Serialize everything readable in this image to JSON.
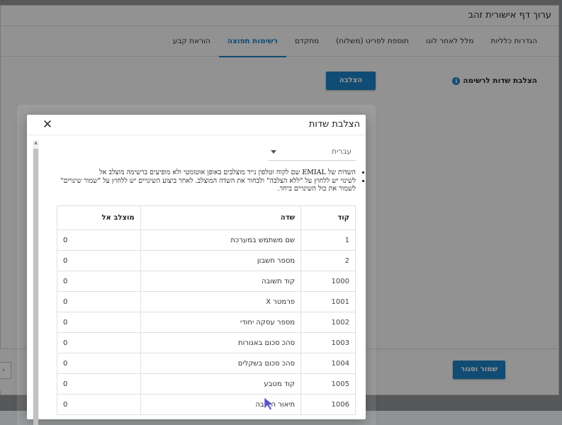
{
  "window": {
    "title": "ערוך דף אישורית זהב"
  },
  "tabs": [
    {
      "label": "הגדרות כלליות",
      "active": false
    },
    {
      "label": "מלל לאחר לוגו",
      "active": false
    },
    {
      "label": "תוספת לפריט (משלוח)",
      "active": false
    },
    {
      "label": "מתקדם",
      "active": false
    },
    {
      "label": "רשימות תפוצה",
      "active": true
    },
    {
      "label": "הוראת קבע",
      "active": false
    }
  ],
  "section": {
    "label": "הצלבת שדות לרשימה",
    "pin_button": "הצלבה"
  },
  "footer": {
    "save_close": "שמור וסגור"
  },
  "modal": {
    "title": "הצלבת שדות",
    "language": {
      "value": "עברית"
    },
    "notes": [
      "השדות של EMIAL שם לקוח וטלפון נייד מוצלבים באופן אוטומטי ולא מופיעים ברשימה מוצלב אל",
      "לשינוי יש ללחוץ על \"ללא הצלבה\" ולבחור את השדה המוצלב. לאחר ביצוע השינויים יש ללחוץ על \"שמור שינויים\" לשמור את כול השינויים ביחד."
    ],
    "table": {
      "headers": {
        "code": "קוד",
        "field": "שדה",
        "pinned": "מוצלב אל"
      },
      "rows": [
        {
          "code": "1",
          "field": "שם משתמש במערכת",
          "pinned": "0"
        },
        {
          "code": "2",
          "field": "מספר חשבון",
          "pinned": "0"
        },
        {
          "code": "1000",
          "field": "קוד תשובה",
          "pinned": "0"
        },
        {
          "code": "1001",
          "field": "פרמטר X",
          "pinned": "0"
        },
        {
          "code": "1002",
          "field": "מספר עסקה יחודי",
          "pinned": "0"
        },
        {
          "code": "1003",
          "field": "סהכ סכום באגורות",
          "pinned": "0"
        },
        {
          "code": "1004",
          "field": "סהכ סכום בשקלים",
          "pinned": "0"
        },
        {
          "code": "1005",
          "field": "קוד מטבע",
          "pinned": "0"
        },
        {
          "code": "1006",
          "field": "תיאור תשובה",
          "pinned": "0"
        }
      ]
    }
  },
  "colors": {
    "accent": "#1c7fc0",
    "overlay": "rgba(0,0,0,0.40)"
  }
}
